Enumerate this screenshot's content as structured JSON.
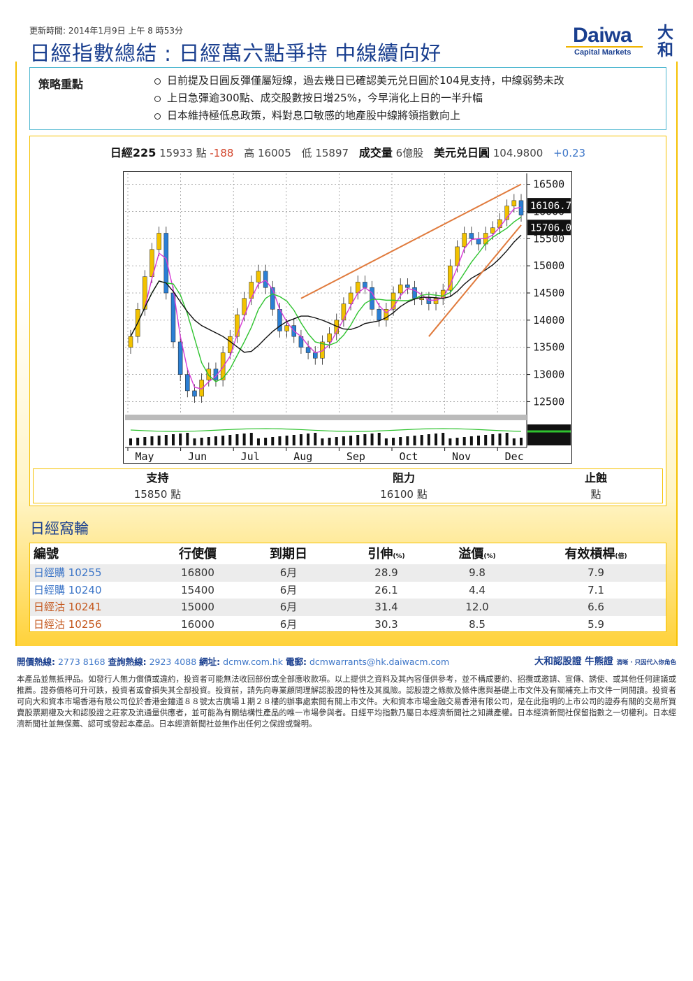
{
  "header": {
    "updated": "更新時間: 2014年1月9日 上午 8 時53分",
    "title": "日經指數總結 : 日經萬六點爭持 中線續向好",
    "logo": {
      "brand": "Daiwa",
      "sub": "Capital Markets",
      "kanji_top": "大",
      "kanji_bottom": "和"
    }
  },
  "strategy": {
    "label": "策略重點",
    "points": [
      "日前提及日圓反彈僅屬短線，過去幾日已確認美元兑日圓於104見支持，中線弱勢未改",
      "上日急彈逾300點、成交股數按日增25%，今早消化上日的一半升幅",
      "日本維持極低息政策，料對息口敏感的地產股中線將領指數向上"
    ]
  },
  "quote": {
    "index_label": "日經225",
    "index_value": "15933 點",
    "change": "-188",
    "high_label": "高",
    "high": "16005",
    "low_label": "低",
    "low": "15897",
    "volume_label": "成交量",
    "volume": "6億股",
    "fx_label": "美元兑日圓",
    "fx_value": "104.9800",
    "fx_change": "+0.23"
  },
  "chart_data": {
    "type": "candlestick",
    "x_ticks": [
      "May",
      "Jun",
      "Jul",
      "Aug",
      "Sep",
      "Oct",
      "Nov",
      "Dec"
    ],
    "y_ticks": [
      12500,
      13000,
      13500,
      14000,
      14500,
      15000,
      15500,
      16000,
      16500
    ],
    "ylim": [
      12300,
      16700
    ],
    "price_tags": [
      "16106.71",
      "15706.09"
    ],
    "series": [
      {
        "name": "close",
        "values": [
          13700,
          14200,
          14800,
          15300,
          15600,
          14500,
          13600,
          13000,
          12700,
          12600,
          12900,
          13100,
          12900,
          13400,
          13700,
          14100,
          14400,
          14700,
          14900,
          14600,
          14200,
          13800,
          13900,
          13700,
          13500,
          13400,
          13300,
          13600,
          13750,
          14000,
          14300,
          14500,
          14700,
          14600,
          14200,
          14000,
          14200,
          14500,
          14650,
          14600,
          14400,
          14400,
          14300,
          14400,
          14550,
          15000,
          15350,
          15600,
          15500,
          15400,
          15600,
          15700,
          15850,
          16100,
          16200,
          15933
        ]
      }
    ],
    "colors": {
      "up": "#f2c200",
      "down": "#2b7fd4",
      "ma_short": "#d63bd6",
      "ma_mid": "#2fc32f",
      "ma_long": "#111111",
      "trend": "#e07a3c"
    }
  },
  "levels": {
    "support_label": "支持",
    "support_value": "15850 點",
    "resistance_label": "阻力",
    "resistance_value": "16100 點",
    "stoploss_label": "止蝕",
    "stoploss_value": "點"
  },
  "warrants": {
    "title": "日經窩輪",
    "headers": {
      "code": "編號",
      "strike": "行使價",
      "expiry": "到期日",
      "gearing": "引伸",
      "gearing_unit": "(%)",
      "premium": "溢價",
      "premium_unit": "(%)",
      "leverage": "有效槓桿",
      "leverage_unit": "(倍)"
    },
    "rows": [
      {
        "code": "日經購 10255",
        "strike": "16800",
        "expiry": "6月",
        "gearing": "28.9",
        "premium": "9.8",
        "leverage": "7.9"
      },
      {
        "code": "日經購 10240",
        "strike": "15400",
        "expiry": "6月",
        "gearing": "26.1",
        "premium": "4.4",
        "leverage": "7.1"
      },
      {
        "code": "日經沽 10241",
        "strike": "15000",
        "expiry": "6月",
        "gearing": "31.4",
        "premium": "12.0",
        "leverage": "6.6"
      },
      {
        "code": "日經沽 10256",
        "strike": "16000",
        "expiry": "6月",
        "gearing": "30.3",
        "premium": "8.5",
        "leverage": "5.9"
      }
    ]
  },
  "footer": {
    "hotline_label": "開價熱線:",
    "hotline": "2773 8168",
    "enquiry_label": "查詢熱線:",
    "enquiry": "2923 4088",
    "web_label": "網址:",
    "web": "dcmw.com.hk",
    "email_label": "電郵:",
    "email": "dcmwarrants@hk.daiwacm.com",
    "brand": "大和認股證 牛熊證",
    "brand_slogan": "清晰 · 只因代入你角色",
    "disclaimer": "本產品並無抵押品。如發行人無力償債或違約，投資者可能無法收回部份或全部應收款項。以上提供之資料及其內容僅供參考，並不構成要約、招攬或邀請、宣傳、誘使、或其他任何建議或推薦。證券價格可升可跌，投資者或會損失其全部投資。投資前，請先向專業顧問理解認股證的特性及其風險。認股證之條款及條件應與基礎上市文件及有關補充上市文件一同閱讀。投資者可向大和資本市場香港有限公司位於香港金鐘道８８號太古廣場１期２８樓的辦事處索閱有關上市文件。大和資本市場金融交易香港有限公司，是在此指明的上市公司的證券有關的交易所買賣股票期權及大和認股證之莊家及流通量供應者，並可能為有關結構性產品的唯一市場參與者。日經平均指數乃屬日本經濟新聞社之知識產權。日本經濟新聞社保留指數之一切權利。日本經濟新聞社並無保薦、認可或發起本產品。日本經濟新聞社並無作出任何之保證或聲明。"
  }
}
